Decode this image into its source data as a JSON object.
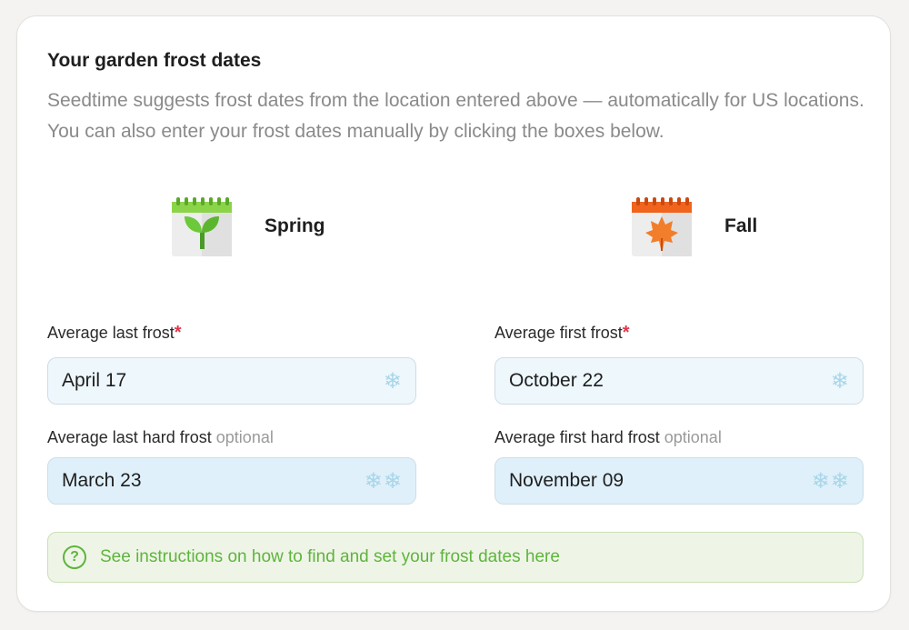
{
  "card": {
    "title": "Your garden frost dates",
    "description": "Seedtime suggests frost dates from the location entered above — automatically for US locations. You can also enter your frost dates manually by clicking the boxes below."
  },
  "seasons": {
    "spring": {
      "label": "Spring",
      "icon": "calendar-seedling-icon"
    },
    "fall": {
      "label": "Fall",
      "icon": "calendar-maple-leaf-icon"
    }
  },
  "fields": {
    "last_frost": {
      "label": "Average last frost",
      "required_mark": "*",
      "value": "April 17",
      "icon": "snowflake-icon"
    },
    "first_frost": {
      "label": "Average first frost",
      "required_mark": "*",
      "value": "October 22",
      "icon": "snowflake-icon"
    },
    "last_hard_frost": {
      "label": "Average last hard frost",
      "optional": "optional",
      "value": "March 23",
      "icon": "double-snowflake-icon"
    },
    "first_hard_frost": {
      "label": "Average first hard frost",
      "optional": "optional",
      "value": "November 09",
      "icon": "double-snowflake-icon"
    }
  },
  "instructions": {
    "icon_glyph": "?",
    "text": "See instructions on how to find and set your frost dates here"
  },
  "colors": {
    "required": "#e0364a",
    "accent_green": "#5fb43d",
    "field_bg": "#eef7fc",
    "hard_field_bg": "#dff0fa"
  }
}
